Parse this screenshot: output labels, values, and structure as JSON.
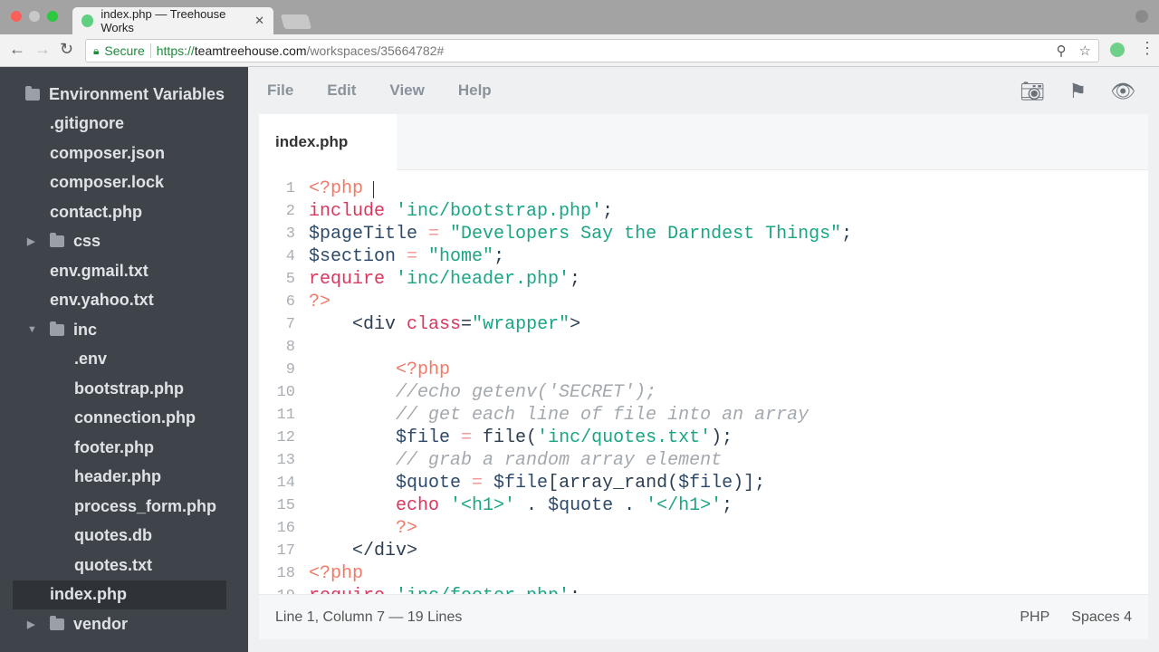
{
  "browser": {
    "tab_title": "index.php — Treehouse Works",
    "secure_label": "Secure",
    "url_scheme": "https://",
    "url_host": "teamtreehouse.com",
    "url_path": "/workspaces/35664782#"
  },
  "sidebar": {
    "items": [
      {
        "label": "Environment Variables",
        "type": "folder",
        "depth": 0,
        "arrow": ""
      },
      {
        "label": ".gitignore",
        "type": "file",
        "depth": 1
      },
      {
        "label": "composer.json",
        "type": "file",
        "depth": 1
      },
      {
        "label": "composer.lock",
        "type": "file",
        "depth": 1
      },
      {
        "label": "contact.php",
        "type": "file",
        "depth": 1
      },
      {
        "label": "css",
        "type": "folder",
        "depth": 1,
        "arrow": "▶"
      },
      {
        "label": "env.gmail.txt",
        "type": "file",
        "depth": 1
      },
      {
        "label": "env.yahoo.txt",
        "type": "file",
        "depth": 1
      },
      {
        "label": "inc",
        "type": "folder",
        "depth": 1,
        "arrow": "▼"
      },
      {
        "label": ".env",
        "type": "file",
        "depth": 2
      },
      {
        "label": "bootstrap.php",
        "type": "file",
        "depth": 2
      },
      {
        "label": "connection.php",
        "type": "file",
        "depth": 2
      },
      {
        "label": "footer.php",
        "type": "file",
        "depth": 2
      },
      {
        "label": "header.php",
        "type": "file",
        "depth": 2
      },
      {
        "label": "process_form.php",
        "type": "file",
        "depth": 2
      },
      {
        "label": "quotes.db",
        "type": "file",
        "depth": 2
      },
      {
        "label": "quotes.txt",
        "type": "file",
        "depth": 2
      },
      {
        "label": "index.php",
        "type": "file",
        "depth": 1,
        "selected": true
      },
      {
        "label": "vendor",
        "type": "folder",
        "depth": 1,
        "arrow": "▶"
      }
    ]
  },
  "menu": {
    "file": "File",
    "edit": "Edit",
    "view": "View",
    "help": "Help"
  },
  "editor": {
    "tab": "index.php",
    "lines": [
      [
        [
          "tag",
          "<?php "
        ]
      ],
      [
        [
          "kw",
          "include "
        ],
        [
          "str",
          "'inc/bootstrap.php'"
        ],
        [
          "pl",
          ";"
        ]
      ],
      [
        [
          "var",
          "$pageTitle "
        ],
        [
          "op",
          "= "
        ],
        [
          "str",
          "\"Developers Say the Darndest Things\""
        ],
        [
          "pl",
          ";"
        ]
      ],
      [
        [
          "var",
          "$section "
        ],
        [
          "op",
          "= "
        ],
        [
          "str",
          "\"home\""
        ],
        [
          "pl",
          ";"
        ]
      ],
      [
        [
          "kw",
          "require "
        ],
        [
          "str",
          "'inc/header.php'"
        ],
        [
          "pl",
          ";"
        ]
      ],
      [
        [
          "tag",
          "?>"
        ]
      ],
      [
        [
          "pl",
          "    <div "
        ],
        [
          "kw",
          "class"
        ],
        [
          "pl",
          "="
        ],
        [
          "str",
          "\"wrapper\""
        ],
        [
          "pl",
          ">"
        ]
      ],
      [],
      [
        [
          "tag",
          "        <?php"
        ]
      ],
      [
        [
          "cm",
          "        //echo getenv('SECRET');"
        ]
      ],
      [
        [
          "cm",
          "        // get each line of file into an array"
        ]
      ],
      [
        [
          "var",
          "        $file "
        ],
        [
          "op",
          "= "
        ],
        [
          "pl",
          "file("
        ],
        [
          "str",
          "'inc/quotes.txt'"
        ],
        [
          "pl",
          ");"
        ]
      ],
      [
        [
          "cm",
          "        // grab a random array element"
        ]
      ],
      [
        [
          "var",
          "        $quote "
        ],
        [
          "op",
          "= "
        ],
        [
          "var",
          "$file"
        ],
        [
          "pl",
          "[array_rand("
        ],
        [
          "var",
          "$file"
        ],
        [
          "pl",
          ")];"
        ]
      ],
      [
        [
          "kw",
          "        echo "
        ],
        [
          "str",
          "'<h1>'"
        ],
        [
          "pl",
          " . "
        ],
        [
          "var",
          "$quote"
        ],
        [
          "pl",
          " . "
        ],
        [
          "str",
          "'</h1>'"
        ],
        [
          "pl",
          ";"
        ]
      ],
      [
        [
          "tag",
          "        ?>"
        ]
      ],
      [
        [
          "pl",
          "    </div>"
        ]
      ],
      [
        [
          "tag",
          "<?php"
        ]
      ],
      [
        [
          "kw",
          "require "
        ],
        [
          "str",
          "'inc/footer.php'"
        ],
        [
          "pl",
          ";"
        ]
      ]
    ]
  },
  "status": {
    "position": "Line 1, Column 7 — 19 Lines",
    "language": "PHP",
    "indent": "Spaces 4"
  }
}
